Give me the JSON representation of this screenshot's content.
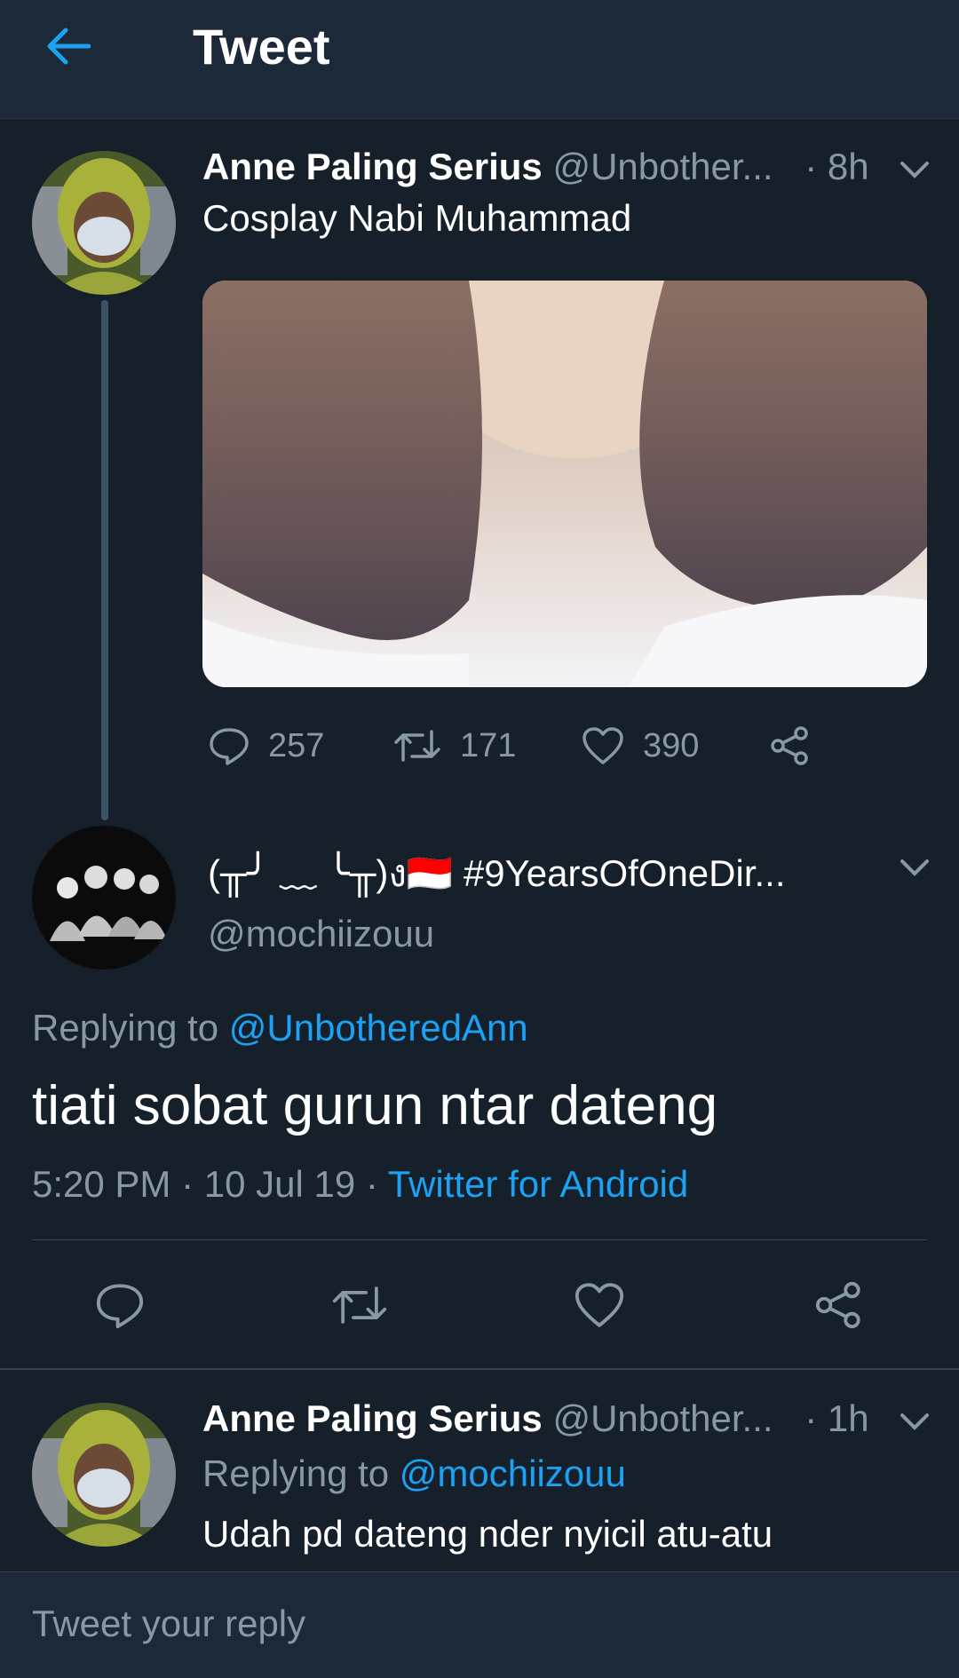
{
  "header": {
    "title": "Tweet",
    "back_icon": "arrow-left-icon"
  },
  "parent_tweet": {
    "display_name": "Anne Paling Serius",
    "handle": "@Unbother...",
    "time": "· 8h",
    "text": "Cosplay Nabi Muhammad",
    "stats": {
      "replies": "257",
      "retweets": "171",
      "likes": "390"
    }
  },
  "main_tweet": {
    "display_name": "(╥╯ ﹏ ╰╥)ง🇮🇩 #9YearsOfOneDir...",
    "handle": "@mochiizouu",
    "replying_prefix": "Replying to ",
    "replying_to": "@UnbotheredAnn",
    "text": "tiati sobat gurun ntar dateng",
    "timestamp": "5:20 PM · 10 Jul 19 · ",
    "source": "Twitter for Android"
  },
  "reply_tweet": {
    "display_name": "Anne Paling Serius",
    "handle": "@Unbother...",
    "time": "· 1h",
    "replying_prefix": "Replying to ",
    "replying_to": "@mochiizouu",
    "text": "Udah pd dateng nder nyicil atu-atu"
  },
  "compose": {
    "placeholder": "Tweet your reply"
  },
  "colors": {
    "background": "#15202b",
    "header": "#1c2938",
    "accent": "#1da1f2",
    "muted": "#8899a6"
  }
}
